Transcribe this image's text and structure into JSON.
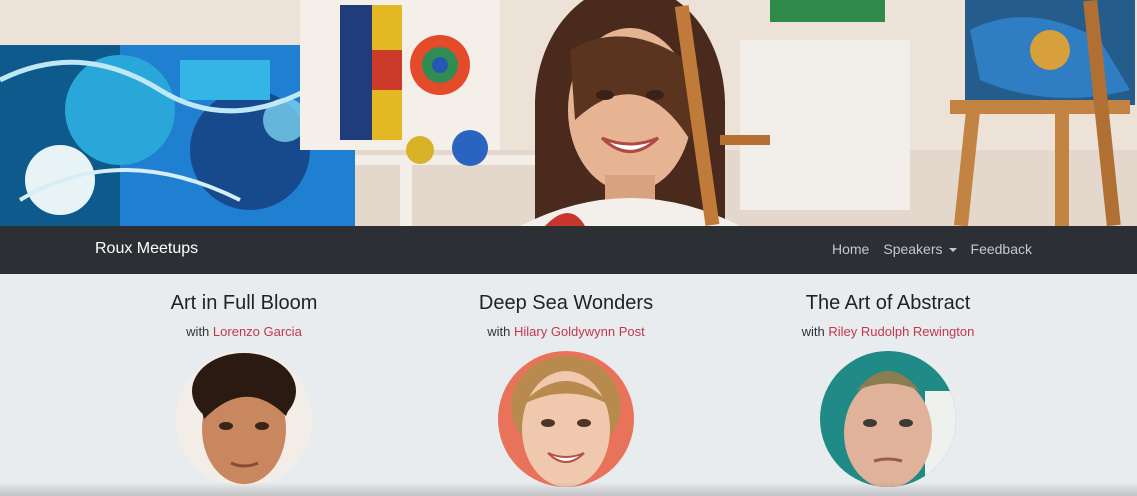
{
  "navbar": {
    "brand": "Roux Meetups",
    "items": [
      {
        "label": "Home"
      },
      {
        "label": "Speakers",
        "dropdown": true
      },
      {
        "label": "Feedback"
      }
    ]
  },
  "sessions": [
    {
      "title": "Art in Full Bloom",
      "with": "with",
      "speaker": "Lorenzo Garcia"
    },
    {
      "title": "Deep Sea Wonders",
      "with": "with",
      "speaker": "Hilary Goldywynn Post"
    },
    {
      "title": "The Art of Abstract",
      "with": "with",
      "speaker": "Riley Rudolph Rewington"
    }
  ],
  "colors": {
    "navbar_bg": "#2c3034",
    "page_bg": "#e9ecef",
    "link": "#c0394b"
  },
  "icons": {
    "dropdown": "caret-down-icon"
  }
}
